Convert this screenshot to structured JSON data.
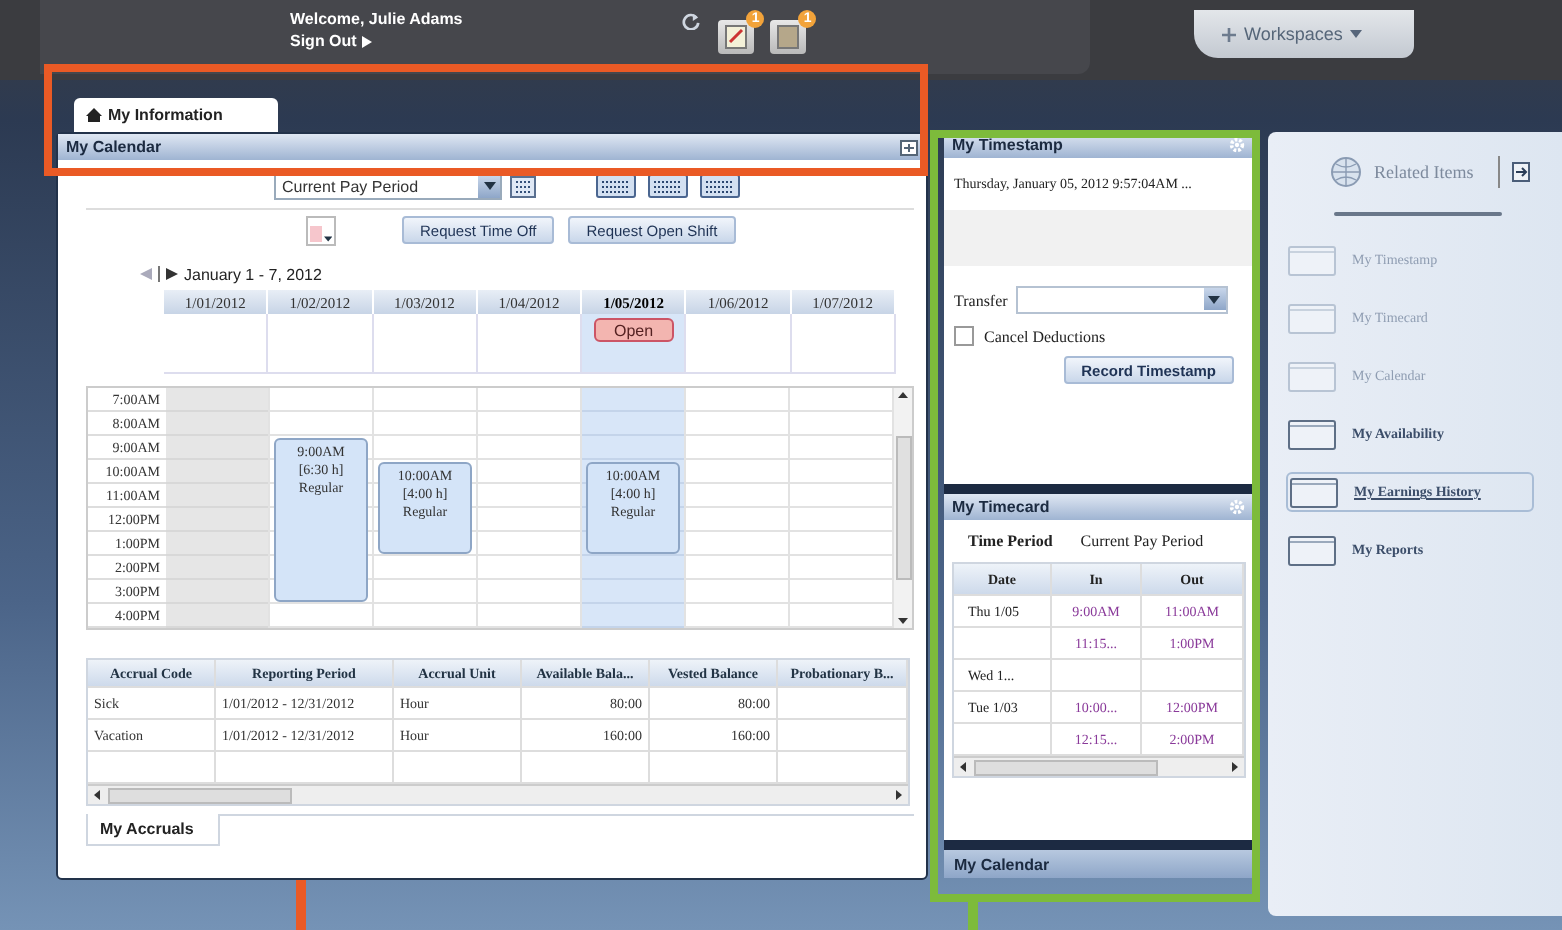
{
  "header": {
    "welcome": "Welcome, Julie Adams",
    "sign_out": "Sign Out",
    "badges": [
      "1",
      "1"
    ],
    "workspaces": "Workspaces"
  },
  "tab": {
    "label": "My Information"
  },
  "calendar": {
    "title": "My Calendar",
    "period": "Current Pay Period",
    "buttons": [
      "Request Time Off",
      "Request Open Shift"
    ],
    "range": "January 1 - 7, 2012",
    "days": [
      {
        "label": "1/01/2012",
        "selected": false,
        "off": true
      },
      {
        "label": "1/02/2012",
        "selected": false,
        "off": false,
        "shift": {
          "time": "9:00AM",
          "hours": "[6:30 h]",
          "type": "Regular"
        }
      },
      {
        "label": "1/03/2012",
        "selected": false,
        "off": false,
        "shift": {
          "time": "10:00AM",
          "hours": "[4:00 h]",
          "type": "Regular"
        }
      },
      {
        "label": "1/04/2012",
        "selected": false,
        "off": false
      },
      {
        "label": "1/05/2012",
        "selected": true,
        "off": false,
        "all_day": "Open",
        "shift": {
          "time": "10:00AM",
          "hours": "[4:00 h]",
          "type": "Regular"
        }
      },
      {
        "label": "1/06/2012",
        "selected": false,
        "off": false
      },
      {
        "label": "1/07/2012",
        "selected": false,
        "off": false
      }
    ],
    "times": [
      "7:00AM",
      "8:00AM",
      "9:00AM",
      "10:00AM",
      "11:00AM",
      "12:00PM",
      "1:00PM",
      "2:00PM",
      "3:00PM",
      "4:00PM"
    ]
  },
  "accruals": {
    "columns": [
      "Accrual Code",
      "Reporting Period",
      "Accrual Unit",
      "Available Bala...",
      "Vested Balance",
      "Probationary B..."
    ],
    "rows": [
      [
        "Sick",
        "1/01/2012 - 12/31/2012",
        "Hour",
        "80:00",
        "80:00"
      ],
      [
        "Vacation",
        "1/01/2012 - 12/31/2012",
        "Hour",
        "160:00",
        "160:00"
      ]
    ],
    "tab": "My Accruals"
  },
  "timestamp": {
    "title": "My Timestamp",
    "datetime": "Thursday, January 05, 2012 9:57:04AM ...",
    "transfer_label": "Transfer",
    "cancel_deductions": {
      "label": "Cancel Deductions",
      "checked": false
    },
    "button": "Record Timestamp"
  },
  "timecard": {
    "title": "My Timecard",
    "period_label": "Time Period",
    "period_value": "Current Pay Period",
    "columns": [
      "Date",
      "In",
      "Out"
    ],
    "rows": [
      {
        "date": "Thu 1/05",
        "in": "9:00AM",
        "out": "11:00AM"
      },
      {
        "in": "11:15...",
        "out": "1:00PM"
      },
      {
        "date": "Wed 1..."
      },
      {
        "date": "Tue 1/03",
        "in": "10:00...",
        "out": "12:00PM"
      },
      {
        "in": "12:15...",
        "out": "2:00PM"
      }
    ]
  },
  "collapsed_panel": {
    "title": "My Calendar"
  },
  "related": {
    "title": "Related Items",
    "items": [
      {
        "label": "My Timestamp",
        "disabled": true,
        "selected": false
      },
      {
        "label": "My Timecard",
        "disabled": true,
        "selected": false
      },
      {
        "label": "My Calendar",
        "disabled": true,
        "selected": false
      },
      {
        "label": "My Availability",
        "disabled": false,
        "selected": false
      },
      {
        "label": "My Earnings History",
        "disabled": false,
        "selected": true
      },
      {
        "label": "My Reports",
        "disabled": false,
        "selected": false
      }
    ]
  }
}
